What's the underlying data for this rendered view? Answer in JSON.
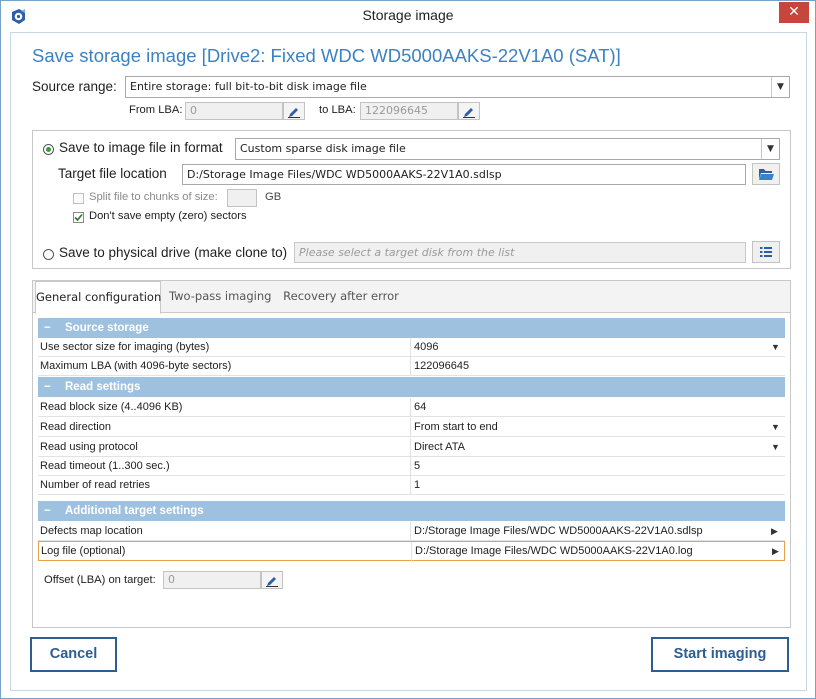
{
  "window": {
    "title": "Storage image",
    "close_glyph": "✕"
  },
  "header": {
    "heading": "Save storage image [Drive2: Fixed WDC WD5000AAKS-22V1A0 (SAT)]"
  },
  "source": {
    "range_label": "Source range:",
    "range_value": "Entire storage: full bit-to-bit disk image file",
    "from_label": "From LBA:",
    "from_value": "0",
    "to_label": "to LBA:",
    "to_value": "122096645"
  },
  "save_file": {
    "radio_label": "Save to image file in format",
    "format_value": "Custom sparse disk image file",
    "target_label": "Target file location",
    "target_value": "D:/Storage Image Files/WDC WD5000AAKS-22V1A0.sdlsp",
    "split_label": "Split file to chunks of size:",
    "split_unit": "GB",
    "no_empty_label": "Don't save empty (zero) sectors",
    "no_empty_checked": true,
    "split_checked": false
  },
  "save_drive": {
    "radio_label": "Save to physical drive (make clone to)",
    "placeholder": "Please select a target disk from the list"
  },
  "tabs": [
    {
      "label": "General configuration",
      "active": true
    },
    {
      "label": "Two-pass imaging",
      "active": false
    },
    {
      "label": "Recovery after error",
      "active": false
    }
  ],
  "grid": {
    "collapse_glyph": "−",
    "dropdown_glyph": "▼",
    "arrow_glyph": "▶",
    "sections": [
      {
        "title": "Source storage",
        "rows": [
          {
            "key": "Use sector size for imaging (bytes)",
            "value": "4096",
            "indicator": "dropdown"
          },
          {
            "key": "Maximum LBA (with 4096-byte sectors)",
            "value": "122096645",
            "indicator": ""
          }
        ]
      },
      {
        "title": "Read settings",
        "rows": [
          {
            "key": "Read block size (4..4096 KB)",
            "value": "64",
            "indicator": ""
          },
          {
            "key": "Read direction",
            "value": "From start to end",
            "indicator": "dropdown"
          },
          {
            "key": "Read using protocol",
            "value": "Direct ATA",
            "indicator": "dropdown"
          },
          {
            "key": "Read timeout (1..300 sec.)",
            "value": "5",
            "indicator": ""
          },
          {
            "key": "Number of read retries",
            "value": "1",
            "indicator": ""
          }
        ]
      },
      {
        "title": "Additional target settings",
        "rows": [
          {
            "key": "Defects map location",
            "value": "D:/Storage Image Files/WDC WD5000AAKS-22V1A0.sdlsp",
            "indicator": "arrow"
          },
          {
            "key": "Log file (optional)",
            "value": "D:/Storage Image Files/WDC WD5000AAKS-22V1A0.log",
            "indicator": "arrow"
          }
        ]
      }
    ]
  },
  "offset": {
    "label": "Offset (LBA) on target:",
    "value": "0"
  },
  "buttons": {
    "cancel": "Cancel",
    "start": "Start imaging"
  },
  "colors": {
    "accent": "#3c82c3",
    "section_header": "#9ec1e0",
    "close": "#c7453a",
    "button_border": "#2e5e8e",
    "highlight_border": "#e9a04a"
  }
}
